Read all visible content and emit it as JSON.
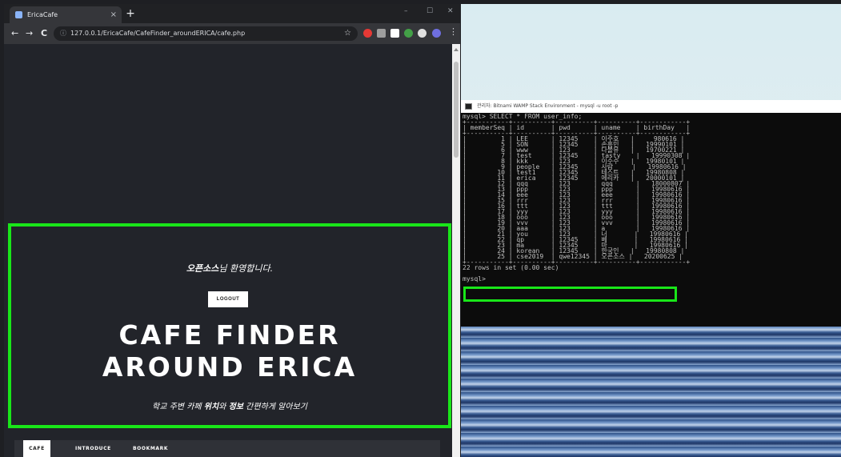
{
  "browser": {
    "tab_title": "EricaCafe",
    "tab_close": "×",
    "new_tab": "+",
    "window_controls": [
      "–",
      "☐",
      "✕"
    ],
    "nav": {
      "back": "←",
      "forward": "→",
      "reload": "C"
    },
    "url_icon": "ⓘ",
    "url": "127.0.0.1/EricaCafe/CafeFinder_aroundERICA/cafe.php",
    "bookmark_star": "☆",
    "menu": "⋮",
    "extension_colors": [
      "#e53935",
      "#9e9e9e",
      "#ffffff",
      "#43a047",
      "#e0e0e0",
      "#6f6fe0"
    ]
  },
  "page": {
    "welcome_user": "오픈소스",
    "welcome_suffix": "님 환영합니다.",
    "logout_label": "LOGOUT",
    "title_line1": "CAFE FINDER",
    "title_line2": "AROUND ERICA",
    "subtitle_pre": "학교 주변 카페 ",
    "subtitle_b1": "위치",
    "subtitle_mid": "와 ",
    "subtitle_b2": "정보",
    "subtitle_post": " 간편하게 알아보기",
    "nav": [
      "CAFE",
      "INTRODUCE",
      "BOOKMARK"
    ],
    "accent": "#19e619"
  },
  "console": {
    "title": "관리자: Bitnami WAMP Stack Environment - mysql  -u root -p",
    "lines": [
      "mysql> SELECT * FROM user_info;",
      "+-----------+----------+----------+----------+------------+",
      "| memberSeq | id       | pwd      | uname    | birthDay   |",
      "+-----------+----------+----------+----------+------------+",
      "|         1 | LEE      | 12345    | 이주호   |     980616 |",
      "|         5 | SON      | 12345    | 손흥민   |   19990101 |",
      "|         6 | www      | 123      | 다볼유   |   19700221 |",
      "|         7 | test     | 12345    | tasty    |   19990308 |",
      "|         8 | kkk      | 123      | 이수수   |   19980101 |",
      "|         9 | people   | 12345    | 사람     |   19980616 |",
      "|        10 | test1    | 12345    | 테스트   |   19980808 |",
      "|        11 | erica    | 12345    | 에리카   |   20000101 |",
      "|        12 | qqq      | 123      | qqq      |   18000807 |",
      "|        13 | ppp      | 123      | ppp      |   19980616 |",
      "|        14 | eee      | 123      | eee      |   19980616 |",
      "|        15 | rrr      | 123      | rrr      |   19980616 |",
      "|        16 | ttt      | 123      | ttt      |   19980616 |",
      "|        17 | yyy      | 123      | yyy      |   19980616 |",
      "|        18 | ooo      | 123      | ooo      |   19980616 |",
      "|        19 | vvv      | 123      | vvv      |   19980616 |",
      "|        20 | aaa      | 123      | a        |   19980616 |",
      "|        21 | you      | 123      | 너       |   19980616 |",
      "|        22 | qp       | 12345    | 베       |   19980616 |",
      "|        23 | ma       | 12345    | 마       |   19980616 |",
      "|        24 | korean   | 12345    | 한국인   |   19980808 |",
      "|        25 | cse2019  | qwe12345 | 오픈소스 |   20200625 |",
      "+-----------+----------+----------+----------+------------+",
      "22 rows in set (0.00 sec)",
      "",
      "mysql>"
    ]
  }
}
